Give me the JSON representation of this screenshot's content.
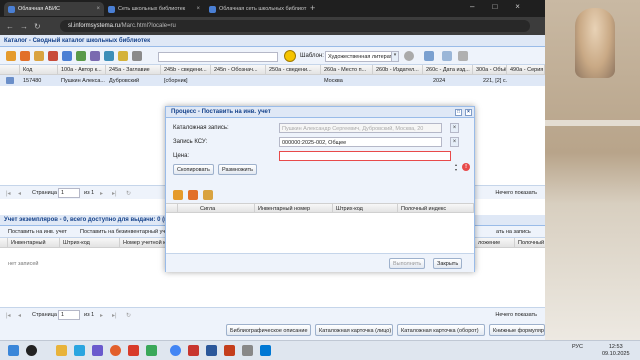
{
  "browser": {
    "tabs": [
      {
        "label": "Облачная АБИС",
        "active": true
      },
      {
        "label": "Сеть школьных библиотек",
        "active": false
      },
      {
        "label": "Облачная сеть школьных библиот",
        "active": false
      }
    ],
    "url_host": "sl.informsystema.ru",
    "url_path": "/Marc.html?locale=ru"
  },
  "catalog": {
    "title": "Каталог - Сводный каталог школьных библиотек",
    "template_label": "Шаблон:",
    "template_value": "Художественная литерат",
    "columns": [
      "Код",
      "100a - Автор к...",
      "245a - Заглавие",
      "245b - сведени...",
      "245n - Обознач...",
      "250a - сведени...",
      "260a - Место п...",
      "260b - Издател...",
      "260c - Дата изд...",
      "300a - Объём",
      "490a - Серия",
      "521c - Читател..."
    ],
    "rows": [
      [
        "157480",
        "Пушкин Алекса...",
        "Дубровский",
        "[сборник]",
        "",
        "",
        "Москва",
        "",
        "2024",
        "221, [2] с.",
        "",
        ""
      ]
    ],
    "pager": {
      "page_label": "Страница",
      "page_value": "1",
      "of_label": "из 1",
      "empty_label": "Нечего показать"
    }
  },
  "copies": {
    "title": "Учет экземпляров - 0, всего доступно для выдачи: 0 (выдано 0)",
    "buttons": [
      "Поставить на инв. учет",
      "Поставить на безинвентарный уч",
      "ать на запись"
    ],
    "columns": [
      "Инвентарный",
      "Штрих-код",
      "Номер учетной к",
      "ложение",
      "Полочный индекс",
      "Доступн. для выд"
    ],
    "no_records": "нет записей",
    "pager": {
      "page_label": "Страница",
      "page_value": "1",
      "of_label": "из 1",
      "empty_label": "Нечего показать"
    }
  },
  "bottom_buttons": [
    "Библиографическое описание",
    "Каталожная карточка (лицо)",
    "Каталожная карточка (оборот)",
    "Книжные формуляры",
    "Читательское требование"
  ],
  "modal": {
    "title": "Процесс - Поставить на инв. учет",
    "catalog_record_label": "Каталожная запись:",
    "catalog_record_value": "Пушкин Александр Сергеевич, Дубровский, Москва, 20",
    "ksu_label": "Запись КСУ:",
    "ksu_value": "000000:2025-002, Общее",
    "price_label": "Цена:",
    "price_value": "",
    "copy_button": "Скопировать",
    "multiply_button": "Размножить",
    "grid_columns": [
      "",
      "Сигла",
      "Инвентарный номер",
      "Штрих-код",
      "Полочный индекс"
    ],
    "execute_button": "Выполнить",
    "close_button": "Закрыть"
  },
  "taskbar": {
    "tray": "РУС",
    "time": "12:53",
    "date": "09.10.2025"
  }
}
